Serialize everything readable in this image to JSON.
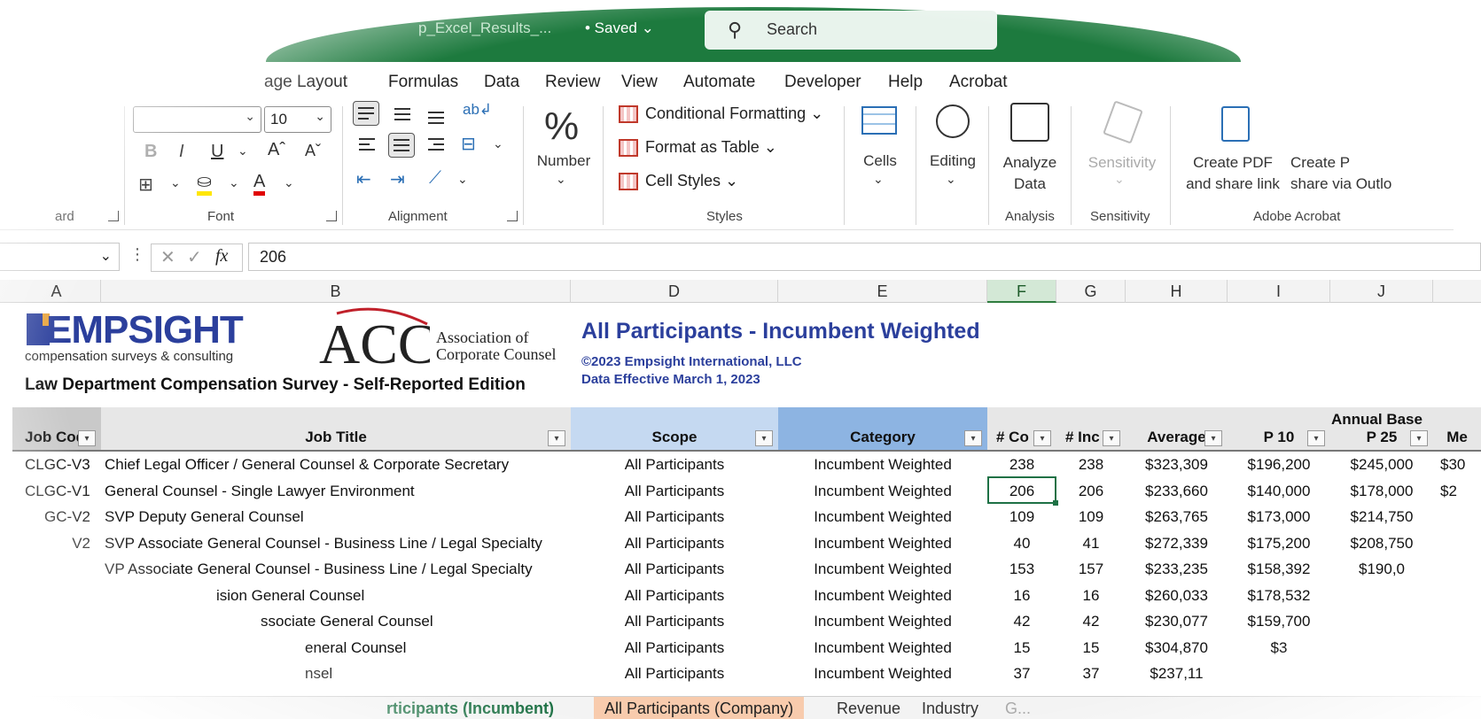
{
  "titlebar": {
    "filename": "p_Excel_Results_...",
    "saved": "• Saved ⌄",
    "search_label": "Search"
  },
  "menu": {
    "tabs": [
      "age Layout",
      "Formulas",
      "Data",
      "Review",
      "View",
      "Automate",
      "Developer",
      "Help",
      "Acrobat"
    ]
  },
  "ribbon": {
    "font_size": "10",
    "groups": {
      "clipboard": "ard",
      "font": "Font",
      "alignment": "Alignment",
      "number": "Number",
      "styles": "Styles",
      "cells": "Cells",
      "editing": "Editing",
      "analysis": "Analysis",
      "sensitivity": "Sensitivity",
      "adobe": "Adobe Acrobat"
    },
    "styles": {
      "conditional": "Conditional Formatting ⌄",
      "format_table": "Format as Table ⌄",
      "cell_styles": "Cell Styles ⌄"
    },
    "number_label": "Number",
    "cells_label": "Cells",
    "editing_label": "Editing",
    "analyze_label_1": "Analyze",
    "analyze_label_2": "Data",
    "sensitivity_label": "Sensitivity",
    "create_pdf_1": "Create PDF",
    "create_pdf_2": "and share link",
    "create_pdf_outlook_1": "Create P",
    "create_pdf_outlook_2": "share via Outlo"
  },
  "formula": {
    "value": "206"
  },
  "columns": [
    "A",
    "B",
    "D",
    "E",
    "F",
    "G",
    "H",
    "I",
    "J"
  ],
  "banner": {
    "logo_name": "EMPSIGHT",
    "logo_tag": "compensation surveys & consulting",
    "survey_title": "Law Department Compensation Survey - Self-Reported Edition",
    "acc_line1": "Association of",
    "acc_line2": "Corporate Counsel",
    "acc_mark": "ACC",
    "main_title": "All Participants - Incumbent Weighted",
    "copyright": "©2023 Empsight International, LLC",
    "effective": "Data Effective March 1, 2023"
  },
  "table": {
    "group_header": "Annual Base",
    "headers": [
      "Job Cod",
      "Job Title",
      "Scope",
      "Category",
      "# Co",
      "# Inc",
      "Average",
      "P 10",
      "P 25",
      "Me"
    ],
    "rows": [
      [
        "CLGC-V3",
        "Chief Legal Officer / General Counsel & Corporate Secretary",
        "All Participants",
        "Incumbent Weighted",
        "238",
        "238",
        "$323,309",
        "$196,200",
        "$245,000",
        "$30"
      ],
      [
        "CLGC-V1",
        "General Counsel - Single Lawyer Environment",
        "All Participants",
        "Incumbent Weighted",
        "206",
        "206",
        "$233,660",
        "$140,000",
        "$178,000",
        "$2"
      ],
      [
        "GC-V2",
        "SVP Deputy General Counsel",
        "All Participants",
        "Incumbent Weighted",
        "109",
        "109",
        "$263,765",
        "$173,000",
        "$214,750",
        ""
      ],
      [
        "V2",
        "SVP Associate General Counsel - Business Line / Legal Specialty",
        "All Participants",
        "Incumbent Weighted",
        "40",
        "41",
        "$272,339",
        "$175,200",
        "$208,750",
        ""
      ],
      [
        "",
        "VP Associate General Counsel - Business Line / Legal Specialty",
        "All Participants",
        "Incumbent Weighted",
        "153",
        "157",
        "$233,235",
        "$158,392",
        "$190,0",
        ""
      ],
      [
        "",
        "ision General Counsel",
        "All Participants",
        "Incumbent Weighted",
        "16",
        "16",
        "$260,033",
        "$178,532",
        "",
        ""
      ],
      [
        "",
        "ssociate General Counsel",
        "All Participants",
        "Incumbent Weighted",
        "42",
        "42",
        "$230,077",
        "$159,700",
        "",
        ""
      ],
      [
        "",
        "eneral Counsel",
        "All Participants",
        "Incumbent Weighted",
        "15",
        "15",
        "$304,870",
        "$3",
        "",
        ""
      ],
      [
        "",
        "nsel",
        "All Participants",
        "Incumbent Weighted",
        "37",
        "37",
        "$237,11",
        "",
        "",
        ""
      ]
    ]
  },
  "sheets": {
    "active": "rticipants (Incumbent)",
    "company": "All Participants (Company)",
    "revenue": "Revenue",
    "industry": "Industry",
    "more": "G..."
  },
  "colors": {
    "excel_green": "#1d7a3e",
    "brand_blue": "#2b3f9c",
    "scope_header": "#c5d9f1",
    "category_header": "#8db4e2",
    "selected_border": "#1e7145"
  }
}
